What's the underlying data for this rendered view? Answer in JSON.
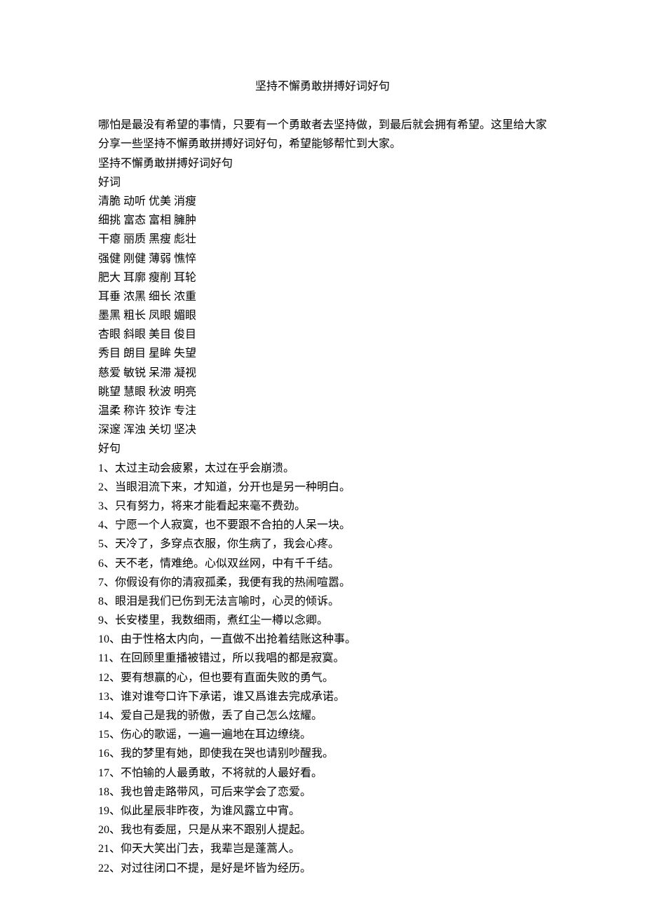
{
  "title": "坚持不懈勇敢拼搏好词好句",
  "intro": "哪怕是最没有希望的事情，只要有一个勇敢者去坚持做，到最后就会拥有希望。这里给大家分享一些坚持不懈勇敢拼搏好词好句，希望能够帮忙到大家。",
  "subtitle": "坚持不懈勇敢拼搏好词好句",
  "goodWordsHeading": "好词",
  "wordRows": [
    "清脆 动听 优美 消瘦",
    "细挑 富态 富相 臃肿",
    "干瘪 丽质 黑瘦 彪壮",
    "强健 刚健 薄弱 憔悴",
    "肥大 耳廓 瘦削 耳轮",
    "耳垂 浓黑 细长 浓重",
    "墨黑 粗长 凤眼 媚眼",
    "杏眼 斜眼 美目 俊目",
    "秀目 朗目 星眸 失望",
    "慈爱 敏锐 呆滞 凝视",
    "眺望 慧眼 秋波 明亮",
    "温柔 称许 狡诈 专注",
    "深邃 浑浊 关切 坚决"
  ],
  "goodSentencesHeading": "好句",
  "sentences": [
    "1、太过主动会疲累，太过在乎会崩溃。",
    "2、当眼泪流下来，才知道，分开也是另一种明白。",
    "3、只有努力，将来才能看起来毫不费劲。",
    "4、宁愿一个人寂寞，也不要跟不合拍的人呆一块。",
    "5、天冷了，多穿点衣服，你生病了，我会心疼。",
    "6、天不老，情难绝。心似双丝网，中有千千结。",
    "7、你假设有你的清寂孤柔，我便有我的热闹喧嚣。",
    "8、眼泪是我们已伤到无法言喻时，心灵的倾诉。",
    "9、长安楼里，我数细雨，煮红尘一樽以念卿。",
    "10、由于性格太内向，一直做不出抢着结账这种事。",
    "11、在回顾里重播被错过，所以我唱的都是寂寞。",
    "12、要有想赢的心，但也要有直面失败的勇气。",
    "13、谁对谁夸口许下承诺，谁又爲谁去完成承诺。",
    "14、爱自己是我的骄傲，丢了自己怎么炫耀。",
    "15、伤心的歌谣，一遍一遍地在耳边缭绕。",
    "16、我的梦里有她，即使我在哭也请别吵醒我。",
    "17、不怕输的人最勇敢，不将就的人最好看。",
    "18、我也曾走路带风，可后来学会了恋爱。",
    "19、似此星辰非昨夜，为谁风露立中宵。",
    "20、我也有委屈，只是从来不跟别人提起。",
    "21、仰天大笑出门去，我辈岂是蓬蒿人。",
    "22、对过往闭口不提，是好是坏皆为经历。"
  ]
}
